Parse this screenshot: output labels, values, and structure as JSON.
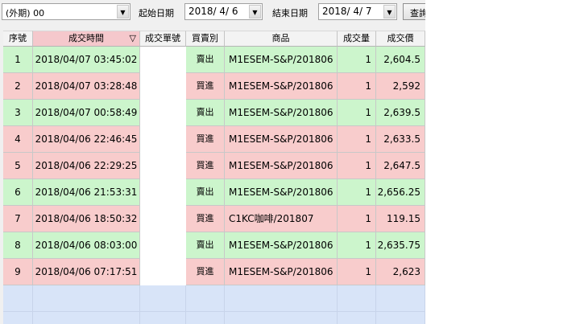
{
  "toolbar": {
    "account_value": "(外期)  00",
    "start_date_label": "起始日期",
    "start_date_value": "2018/  4/  6",
    "end_date_label": "結束日期",
    "end_date_value": "2018/  4/  7",
    "query_label": "查詢"
  },
  "table": {
    "headers": [
      "序號",
      "成交時間",
      "成交單號",
      "買賣別",
      "商品",
      "成交量",
      "成交價"
    ],
    "sort_glyph": "▽",
    "rows": [
      {
        "seq": "1",
        "time": "2018/04/07 03:45:02",
        "order": "",
        "side": "賣出",
        "product": "M1ESEM-S&P/201806",
        "qty": "1",
        "price": "2,604.5",
        "kind": "sell"
      },
      {
        "seq": "2",
        "time": "2018/04/07 03:28:48",
        "order": "",
        "side": "買進",
        "product": "M1ESEM-S&P/201806",
        "qty": "1",
        "price": "2,592",
        "kind": "buy"
      },
      {
        "seq": "3",
        "time": "2018/04/07 00:58:49",
        "order": "",
        "side": "賣出",
        "product": "M1ESEM-S&P/201806",
        "qty": "1",
        "price": "2,639.5",
        "kind": "sell"
      },
      {
        "seq": "4",
        "time": "2018/04/06 22:46:45",
        "order": "",
        "side": "買進",
        "product": "M1ESEM-S&P/201806",
        "qty": "1",
        "price": "2,633.5",
        "kind": "buy"
      },
      {
        "seq": "5",
        "time": "2018/04/06 22:29:25",
        "order": "",
        "side": "買進",
        "product": "M1ESEM-S&P/201806",
        "qty": "1",
        "price": "2,647.5",
        "kind": "buy"
      },
      {
        "seq": "6",
        "time": "2018/04/06 21:53:31",
        "order": "",
        "side": "賣出",
        "product": "M1ESEM-S&P/201806",
        "qty": "1",
        "price": "2,656.25",
        "kind": "sell"
      },
      {
        "seq": "7",
        "time": "2018/04/06 18:50:32",
        "order": "",
        "side": "買進",
        "product": "C1KC咖啡/201807",
        "qty": "1",
        "price": "119.15",
        "kind": "buy"
      },
      {
        "seq": "8",
        "time": "2018/04/06 08:03:00",
        "order": "",
        "side": "賣出",
        "product": "M1ESEM-S&P/201806",
        "qty": "1",
        "price": "2,635.75",
        "kind": "sell"
      },
      {
        "seq": "9",
        "time": "2018/04/06 07:17:51",
        "order": "",
        "side": "買進",
        "product": "M1ESEM-S&P/201806",
        "qty": "1",
        "price": "2,623",
        "kind": "buy"
      }
    ]
  }
}
